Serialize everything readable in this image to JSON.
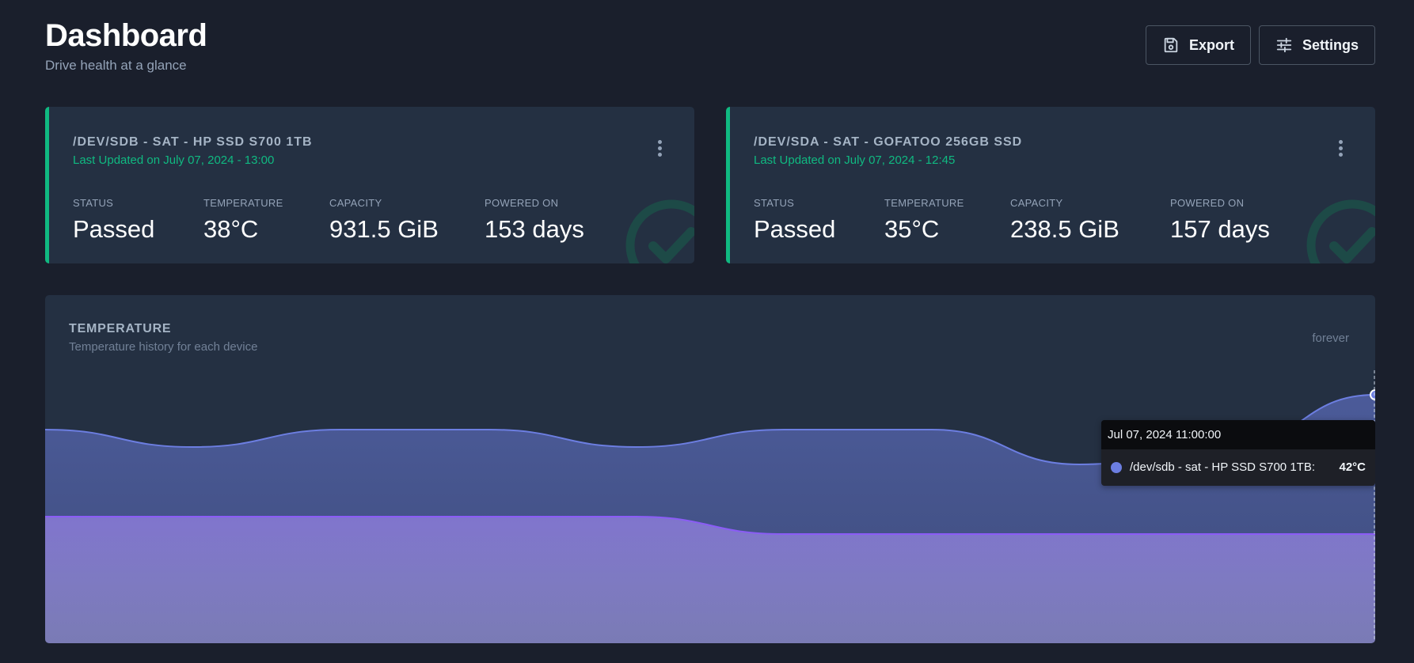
{
  "header": {
    "title": "Dashboard",
    "subtitle": "Drive health at a glance",
    "export_label": "Export",
    "settings_label": "Settings"
  },
  "devices": [
    {
      "title": "/DEV/SDB - SAT - HP SSD S700 1TB",
      "updated": "Last Updated on July 07, 2024 - 13:00",
      "metrics": [
        {
          "label": "STATUS",
          "value": "Passed"
        },
        {
          "label": "TEMPERATURE",
          "value": "38°C"
        },
        {
          "label": "CAPACITY",
          "value": "931.5 GiB"
        },
        {
          "label": "POWERED ON",
          "value": "153 days"
        }
      ]
    },
    {
      "title": "/DEV/SDA - SAT - GOFATOO 256GB SSD",
      "updated": "Last Updated on July 07, 2024 - 12:45",
      "metrics": [
        {
          "label": "STATUS",
          "value": "Passed"
        },
        {
          "label": "TEMPERATURE",
          "value": "35°C"
        },
        {
          "label": "CAPACITY",
          "value": "238.5 GiB"
        },
        {
          "label": "POWERED ON",
          "value": "157 days"
        }
      ]
    }
  ],
  "temperature": {
    "title": "TEMPERATURE",
    "subtitle": "Temperature history for each device",
    "range": "forever",
    "tooltip": {
      "time": "Jul 07, 2024 11:00:00",
      "series": "/dev/sdb - sat - HP SSD S700 1TB:",
      "value": "42°C"
    }
  },
  "colors": {
    "accent_green": "#10b981",
    "series_sdb": "#6c7ee1",
    "series_sda": "#8b5cf6"
  },
  "icons": {
    "export": "floppy-disk-icon",
    "settings": "sliders-icon",
    "menu": "kebab-menu-icon",
    "status": "check-circle-icon"
  },
  "chart_data": {
    "type": "area",
    "title": "TEMPERATURE",
    "y_visible_range": [
      30,
      45
    ],
    "series": [
      {
        "name": "/dev/sdb - sat - HP SSD S700 1TB",
        "color": "#6c7ee1",
        "values": [
          40,
          39,
          40,
          40,
          39,
          40,
          40,
          38,
          39,
          42
        ]
      },
      {
        "name": "/dev/sda - sat - GOFATOO 256GB SSD",
        "color": "#8b5cf6",
        "values": [
          35,
          35,
          35,
          35,
          35,
          34,
          34,
          34,
          34,
          34
        ]
      }
    ]
  }
}
